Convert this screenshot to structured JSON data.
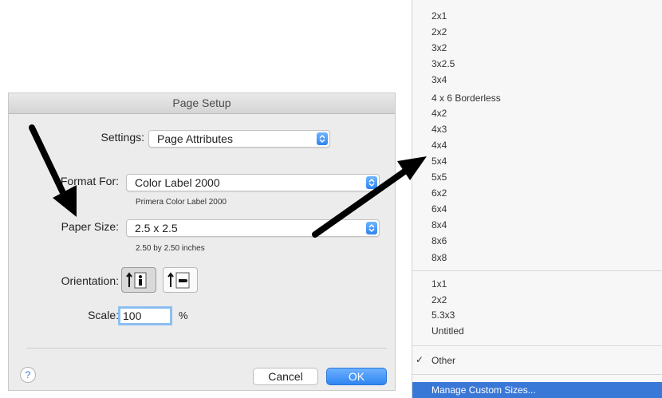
{
  "dialog": {
    "title": "Page Setup",
    "settings_label": "Settings:",
    "settings_value": "Page Attributes",
    "format_label": "Format For:",
    "format_value": "Color Label 2000",
    "format_sub": "Primera Color Label 2000",
    "paper_label": "Paper Size:",
    "paper_value": "2.5 x 2.5",
    "paper_sub": "2.50 by 2.50 inches",
    "orientation_label": "Orientation:",
    "scale_label": "Scale:",
    "scale_value": "100",
    "scale_unit": "%",
    "help_label": "?",
    "cancel_label": "Cancel",
    "ok_label": "OK"
  },
  "menu": {
    "group1": [
      "2x1",
      "2x2",
      "3x2",
      "3x2.5",
      "3x4",
      "4 x 6 Borderless",
      "4x2",
      "4x3",
      "4x4",
      "5x4",
      "5x5",
      "6x2",
      "6x4",
      "8x4",
      "8x6",
      "8x8"
    ],
    "group2": [
      "1x1",
      "2x2",
      "5.3x3",
      "Untitled"
    ],
    "other_check": "✓",
    "other_label": "Other",
    "manage_label": "Manage Custom Sizes..."
  },
  "colors": {
    "accent": "#2f85f1",
    "highlight": "#3a78d8",
    "arrow": "#000000"
  }
}
